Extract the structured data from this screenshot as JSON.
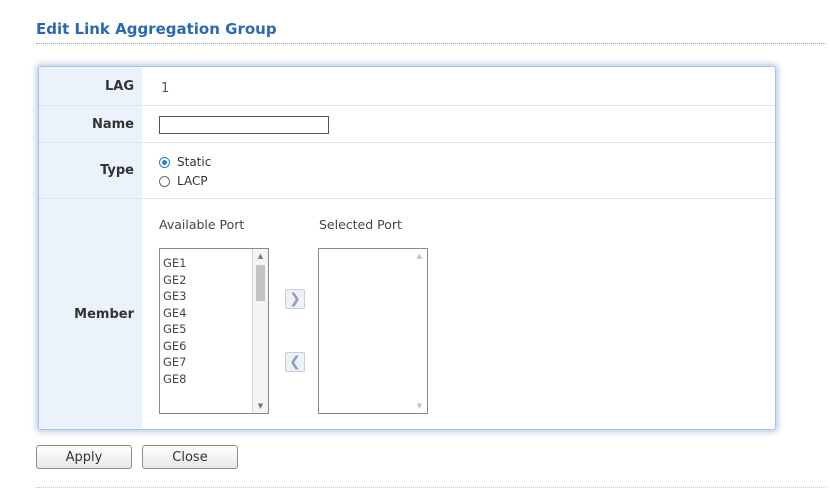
{
  "page": {
    "title": "Edit Link Aggregation Group"
  },
  "form": {
    "lag": {
      "label": "LAG",
      "value": "1"
    },
    "name": {
      "label": "Name",
      "value": "",
      "placeholder": ""
    },
    "type": {
      "label": "Type",
      "options": [
        {
          "label": "Static",
          "selected": true
        },
        {
          "label": "LACP",
          "selected": false
        }
      ]
    },
    "member": {
      "label": "Member",
      "available_heading": "Available Port",
      "selected_heading": "Selected Port",
      "available_ports": [
        "GE1",
        "GE2",
        "GE3",
        "GE4",
        "GE5",
        "GE6",
        "GE7",
        "GE8"
      ],
      "selected_ports": [],
      "add_icon": "chevron-right-icon",
      "remove_icon": "chevron-left-icon"
    }
  },
  "buttons": {
    "apply": "Apply",
    "close": "Close"
  },
  "colors": {
    "title": "#2a6ab4",
    "label_bg": "#eaf3fb",
    "radio_selected": "#2b7fd6"
  }
}
